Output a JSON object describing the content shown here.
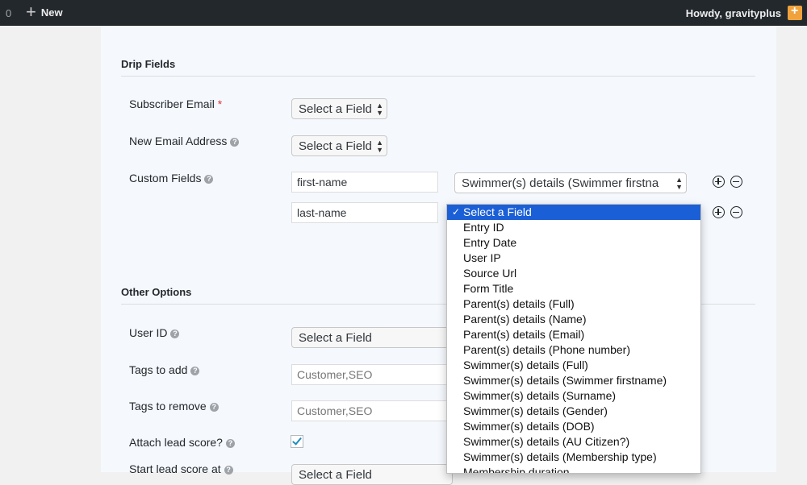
{
  "admin_bar": {
    "count": "0",
    "new_label": "New",
    "howdy": "Howdy, gravityplus"
  },
  "drip_fields": {
    "title": "Drip Fields",
    "subscriber_email": {
      "label": "Subscriber Email",
      "required_mark": "*",
      "select": "Select a Field"
    },
    "new_email_address": {
      "label": "New Email Address",
      "select": "Select a Field"
    },
    "custom_fields": {
      "label": "Custom Fields",
      "rows": [
        {
          "key": "first-name",
          "field": "Swimmer(s) details (Swimmer firstna"
        },
        {
          "key": "last-name",
          "field": "Select a Field"
        }
      ]
    }
  },
  "other_options": {
    "title": "Other Options",
    "user_id": {
      "label": "User ID",
      "select": "Select a Field"
    },
    "tags_to_add": {
      "label": "Tags to add",
      "placeholder": "Customer,SEO"
    },
    "tags_to_remove": {
      "label": "Tags to remove",
      "placeholder": "Customer,SEO"
    },
    "attach_lead_score": {
      "label": "Attach lead score?",
      "checked": true
    },
    "start_lead_score": {
      "label": "Start lead score at",
      "select": "Select a Field"
    }
  },
  "dropdown": {
    "selected_index": 0,
    "options": [
      "Select a Field",
      "Entry ID",
      "Entry Date",
      "User IP",
      "Source Url",
      "Form Title",
      "Parent(s) details (Full)",
      "Parent(s) details (Name)",
      "Parent(s) details (Email)",
      "Parent(s) details (Phone number)",
      "Swimmer(s) details (Full)",
      "Swimmer(s) details (Swimmer firstname)",
      "Swimmer(s) details (Surname)",
      "Swimmer(s) details (Gender)",
      "Swimmer(s) details (DOB)",
      "Swimmer(s) details (AU Citizen?)",
      "Swimmer(s) details (Membership type)",
      "Membership duration"
    ]
  },
  "colors": {
    "admin_bar_bg": "#23282d",
    "panel_bg": "#f5f9fd",
    "selected_option_bg": "#1b5fd6",
    "required": "#d63638"
  }
}
